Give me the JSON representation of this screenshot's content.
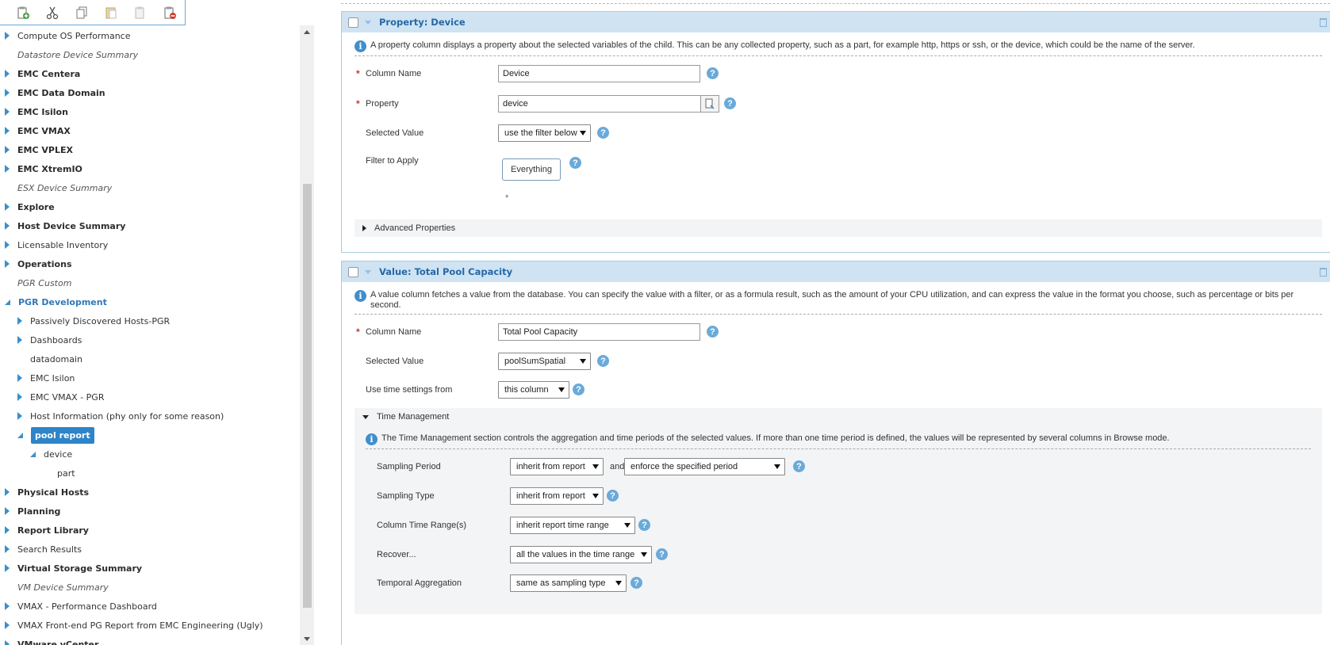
{
  "toolbar": {
    "icons": [
      "clipboard-add-icon",
      "cut-icon",
      "copy-icon",
      "paste-icon",
      "paste-disabled-icon",
      "clipboard-remove-icon"
    ]
  },
  "tree": {
    "items": [
      {
        "label": "Compute OS Performance",
        "style": "normal",
        "expander": "right"
      },
      {
        "label": "Datastore Device Summary",
        "style": "italic",
        "expander": "none"
      },
      {
        "label": "EMC Centera",
        "style": "bold",
        "expander": "right"
      },
      {
        "label": "EMC Data Domain",
        "style": "bold",
        "expander": "right"
      },
      {
        "label": "EMC Isilon",
        "style": "bold",
        "expander": "right"
      },
      {
        "label": "EMC VMAX",
        "style": "bold",
        "expander": "right"
      },
      {
        "label": "EMC VPLEX",
        "style": "bold",
        "expander": "right"
      },
      {
        "label": "EMC XtremIO",
        "style": "bold",
        "expander": "right"
      },
      {
        "label": "ESX Device Summary",
        "style": "italic",
        "expander": "none"
      },
      {
        "label": "Explore",
        "style": "bold",
        "expander": "right"
      },
      {
        "label": "Host Device Summary",
        "style": "bold",
        "expander": "right"
      },
      {
        "label": "Licensable Inventory",
        "style": "normal",
        "expander": "right"
      },
      {
        "label": "Operations",
        "style": "bold",
        "expander": "right"
      },
      {
        "label": "PGR Custom",
        "style": "italic",
        "expander": "none"
      },
      {
        "label": "PGR Development",
        "style": "dev",
        "expander": "open"
      },
      {
        "label": "Passively Discovered Hosts-PGR",
        "style": "normal",
        "expander": "right",
        "indent": 1
      },
      {
        "label": "Dashboards",
        "style": "normal",
        "expander": "right",
        "indent": 1
      },
      {
        "label": "datadomain",
        "style": "normal",
        "expander": "none",
        "indent": 1
      },
      {
        "label": "EMC Isilon",
        "style": "normal",
        "expander": "right",
        "indent": 1
      },
      {
        "label": "EMC VMAX - PGR",
        "style": "normal",
        "expander": "right",
        "indent": 1
      },
      {
        "label": "Host Information (phy only for some reason)",
        "style": "normal",
        "expander": "right",
        "indent": 1
      },
      {
        "label": "pool report",
        "style": "selected",
        "expander": "open",
        "indent": 1
      },
      {
        "label": "device",
        "style": "normal",
        "expander": "open",
        "indent": 2
      },
      {
        "label": "part",
        "style": "normal",
        "expander": "none",
        "indent": 3
      },
      {
        "label": "Physical Hosts",
        "style": "bold",
        "expander": "right"
      },
      {
        "label": "Planning",
        "style": "bold",
        "expander": "right"
      },
      {
        "label": "Report Library",
        "style": "bold",
        "expander": "right"
      },
      {
        "label": "Search Results",
        "style": "normal",
        "expander": "right"
      },
      {
        "label": "Virtual Storage Summary",
        "style": "bold",
        "expander": "right"
      },
      {
        "label": "VM Device Summary",
        "style": "italic",
        "expander": "none"
      },
      {
        "label": "VMAX - Performance Dashboard",
        "style": "normal",
        "expander": "right"
      },
      {
        "label": "VMAX Front-end PG Report from EMC Engineering (Ugly)",
        "style": "normal",
        "expander": "right"
      },
      {
        "label": "VMware vCenter",
        "style": "bold",
        "expander": "right"
      }
    ]
  },
  "property_panel": {
    "title": "Property: Device",
    "info": "A property column displays a property about the selected variables of the child. This can be any collected property, such as a part, for example http, https or ssh, or the device, which could be the name of the server.",
    "column_name_label": "Column Name",
    "column_name_value": "Device",
    "property_label": "Property",
    "property_value": "device",
    "selected_value_label": "Selected Value",
    "selected_value": "use the filter below",
    "filter_label": "Filter to Apply",
    "filter_button": "Everything",
    "asterisk": "*",
    "advanced": "Advanced Properties"
  },
  "value_panel": {
    "title": "Value: Total Pool Capacity",
    "info": "A value column fetches a value from the database. You can specify the value with a filter, or as a formula result, such as the amount of your CPU utilization, and can express the value in the format you choose, such as percentage or bits per second.",
    "column_name_label": "Column Name",
    "column_name_value": "Total Pool Capacity",
    "selected_value_label": "Selected Value",
    "selected_value": "poolSumSpatial",
    "time_settings_label": "Use time settings from",
    "time_settings_value": "this column",
    "time_management": {
      "title": "Time Management",
      "info": "The Time Management section controls the aggregation and time periods of the selected values. If more than one time period is defined, the values will be represented by several columns in Browse mode.",
      "sampling_period_label": "Sampling Period",
      "sampling_period_value": "inherit from report",
      "and_label": "and",
      "enforce_value": "enforce the specified period",
      "sampling_type_label": "Sampling Type",
      "sampling_type_value": "inherit from report",
      "time_range_label": "Column Time Range(s)",
      "time_range_value": "inherit report time range",
      "recover_label": "Recover...",
      "recover_value": "all the values in the time range",
      "temporal_label": "Temporal Aggregation",
      "temporal_value": "same as sampling type"
    }
  },
  "help_glyph": "?",
  "info_glyph": "i",
  "required_glyph": "*"
}
